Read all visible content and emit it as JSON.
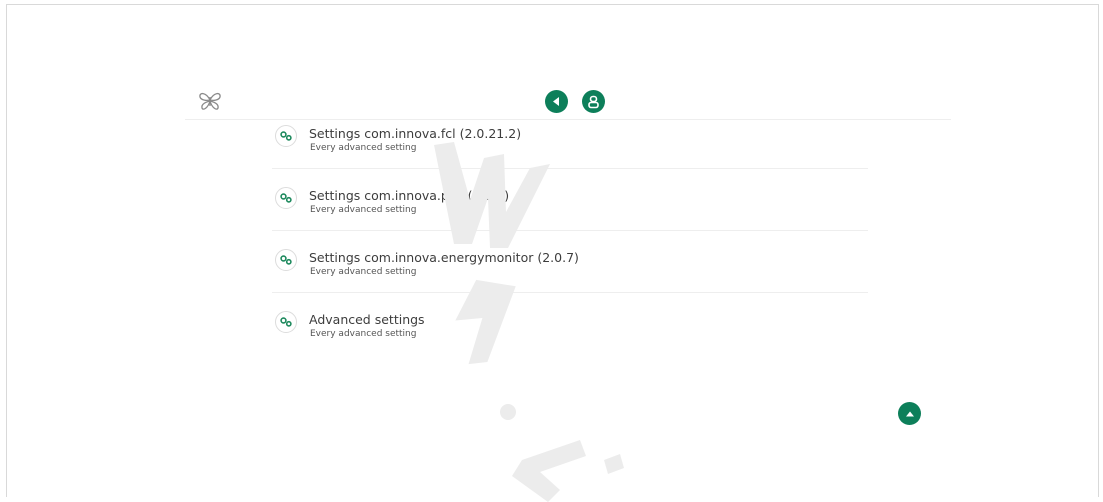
{
  "colors": {
    "accent": "#0d7f5a",
    "icon_green": "#1f8a5e",
    "logo_gray": "#8a8a8a"
  },
  "header": {
    "logo_icon": "butterfly-logo-icon",
    "back_icon": "back-arrow-icon",
    "user_icon": "user-icon"
  },
  "menu": {
    "items": [
      {
        "title": "Settings com.innova.fcl (2.0.21.2)",
        "subtitle": "Every advanced setting",
        "icon": "gears-icon"
      },
      {
        "title": "Settings com.innova.pdc (3.0.5)",
        "subtitle": "Every advanced setting",
        "icon": "gears-icon"
      },
      {
        "title": "Settings com.innova.energymonitor (2.0.7)",
        "subtitle": "Every advanced setting",
        "icon": "gears-icon"
      },
      {
        "title": "Advanced settings",
        "subtitle": "Every advanced setting",
        "icon": "gears-icon"
      }
    ]
  },
  "footer": {
    "scroll_top_icon": "caret-up-icon"
  }
}
